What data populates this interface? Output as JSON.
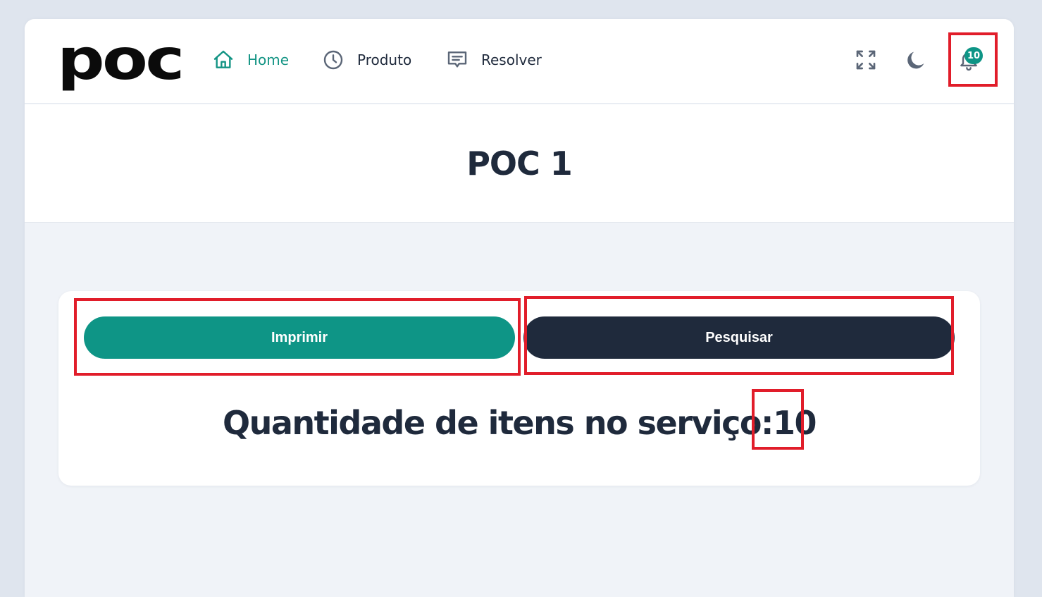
{
  "brand": {
    "logo_text": "poc"
  },
  "nav": {
    "items": [
      {
        "label": "Home",
        "icon": "home-icon",
        "active": true
      },
      {
        "label": "Produto",
        "icon": "clock-icon",
        "active": false
      },
      {
        "label": "Resolver",
        "icon": "message-icon",
        "active": false
      }
    ]
  },
  "toolbar": {
    "fullscreen_icon": "expand-icon",
    "theme_icon": "moon-icon",
    "notifications_icon": "bell-icon",
    "notifications_count": "10"
  },
  "page": {
    "title": "POC 1"
  },
  "actions": {
    "print_label": "Imprimir",
    "search_label": "Pesquisar"
  },
  "service": {
    "label": "Quantidade de itens no serviço:",
    "count": "10"
  },
  "colors": {
    "accent": "#0e9586",
    "dark": "#1f2a3c",
    "highlight": "#e11d2a",
    "page_bg": "#f0f3f8"
  }
}
